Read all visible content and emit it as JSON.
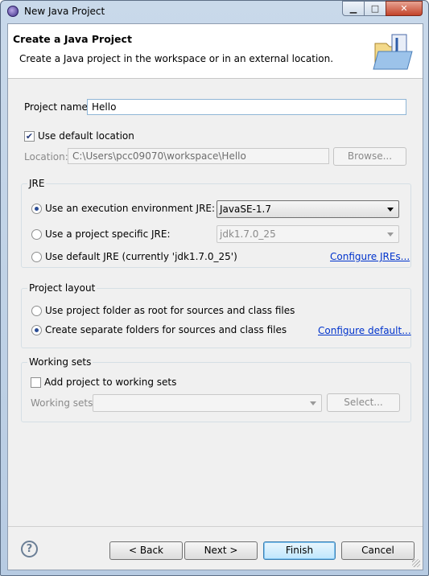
{
  "window": {
    "title": "New Java Project",
    "minimize_glyph": "▁",
    "maximize_glyph": "□",
    "close_glyph": "✕"
  },
  "banner": {
    "title": "Create a Java Project",
    "description": "Create a Java project in the workspace or in an external location.",
    "icon": "java-project-folder-icon"
  },
  "project": {
    "name_label": "Project name:",
    "name_value": "Hello",
    "use_default_location_label": "Use default location",
    "use_default_location_checked": true,
    "location_label": "Location:",
    "location_value": "C:\\Users\\pcc09070\\workspace\\Hello",
    "browse_label": "Browse..."
  },
  "jre": {
    "group_label": "JRE",
    "option_exec_env_label": "Use an execution environment JRE:",
    "exec_env_value": "JavaSE-1.7",
    "option_specific_label": "Use a project specific JRE:",
    "specific_value": "jdk1.7.0_25",
    "option_default_label": "Use default JRE (currently 'jdk1.7.0_25')",
    "configure_link": "Configure JREs...",
    "selected": "exec_env"
  },
  "layout": {
    "group_label": "Project layout",
    "option_root_label": "Use project folder as root for sources and class files",
    "option_separate_label": "Create separate folders for sources and class files",
    "configure_link": "Configure default...",
    "selected": "separate"
  },
  "working_sets": {
    "group_label": "Working sets",
    "add_label": "Add project to working sets",
    "add_checked": false,
    "sets_label": "Working sets:",
    "sets_value": "",
    "select_label": "Select..."
  },
  "footer": {
    "help_glyph": "?",
    "back_label": "< Back",
    "next_label": "Next >",
    "finish_label": "Finish",
    "cancel_label": "Cancel"
  },
  "colors": {
    "link": "#0033cc",
    "radio_dot": "#2a4c94",
    "title_gradient_top": "#c9d9ea"
  }
}
